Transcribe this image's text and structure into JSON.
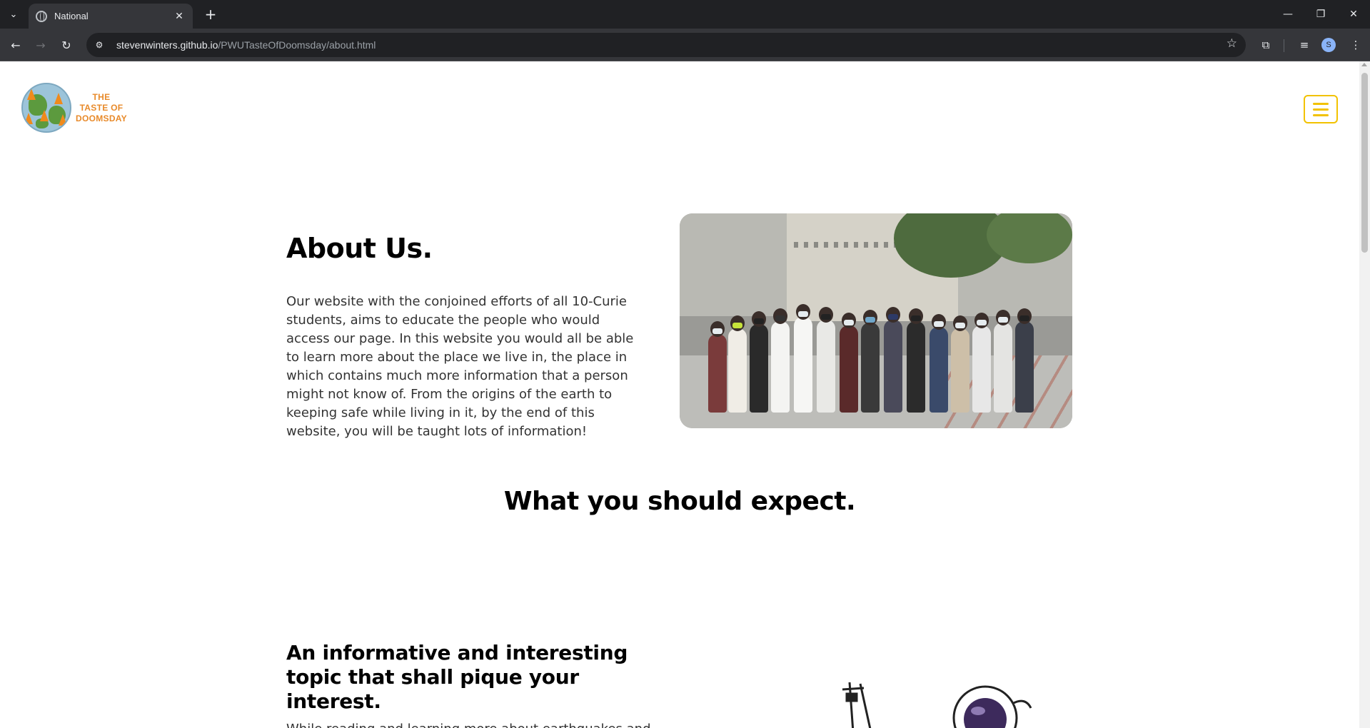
{
  "browser": {
    "tab_title": "National",
    "url_host": "stevenwinters.github.io",
    "url_path": "/PWUTasteOfDoomsday/about.html",
    "profile_initial": "S"
  },
  "header": {
    "logo_line1": "THE",
    "logo_line2": "TASTE OF",
    "logo_line3": "DOOMSDAY",
    "accent_color": "#f2c200",
    "logo_color": "#e88a2a"
  },
  "about": {
    "title": "About Us.",
    "body": "Our website with the conjoined efforts of all 10-Curie students, aims to educate the people who would access our page. In this website you would all be able to learn more about the place we live in, the place in which contains much more information that a person might not know of. From the origins of the earth to keeping safe while living in it, by the end of this website, you will be taught lots of information!"
  },
  "expect": {
    "title": "What you should expect.",
    "topic_title": "An informative and interesting topic that shall pique your interest.",
    "topic_body": "While reading and learning more about earthquakes and"
  }
}
